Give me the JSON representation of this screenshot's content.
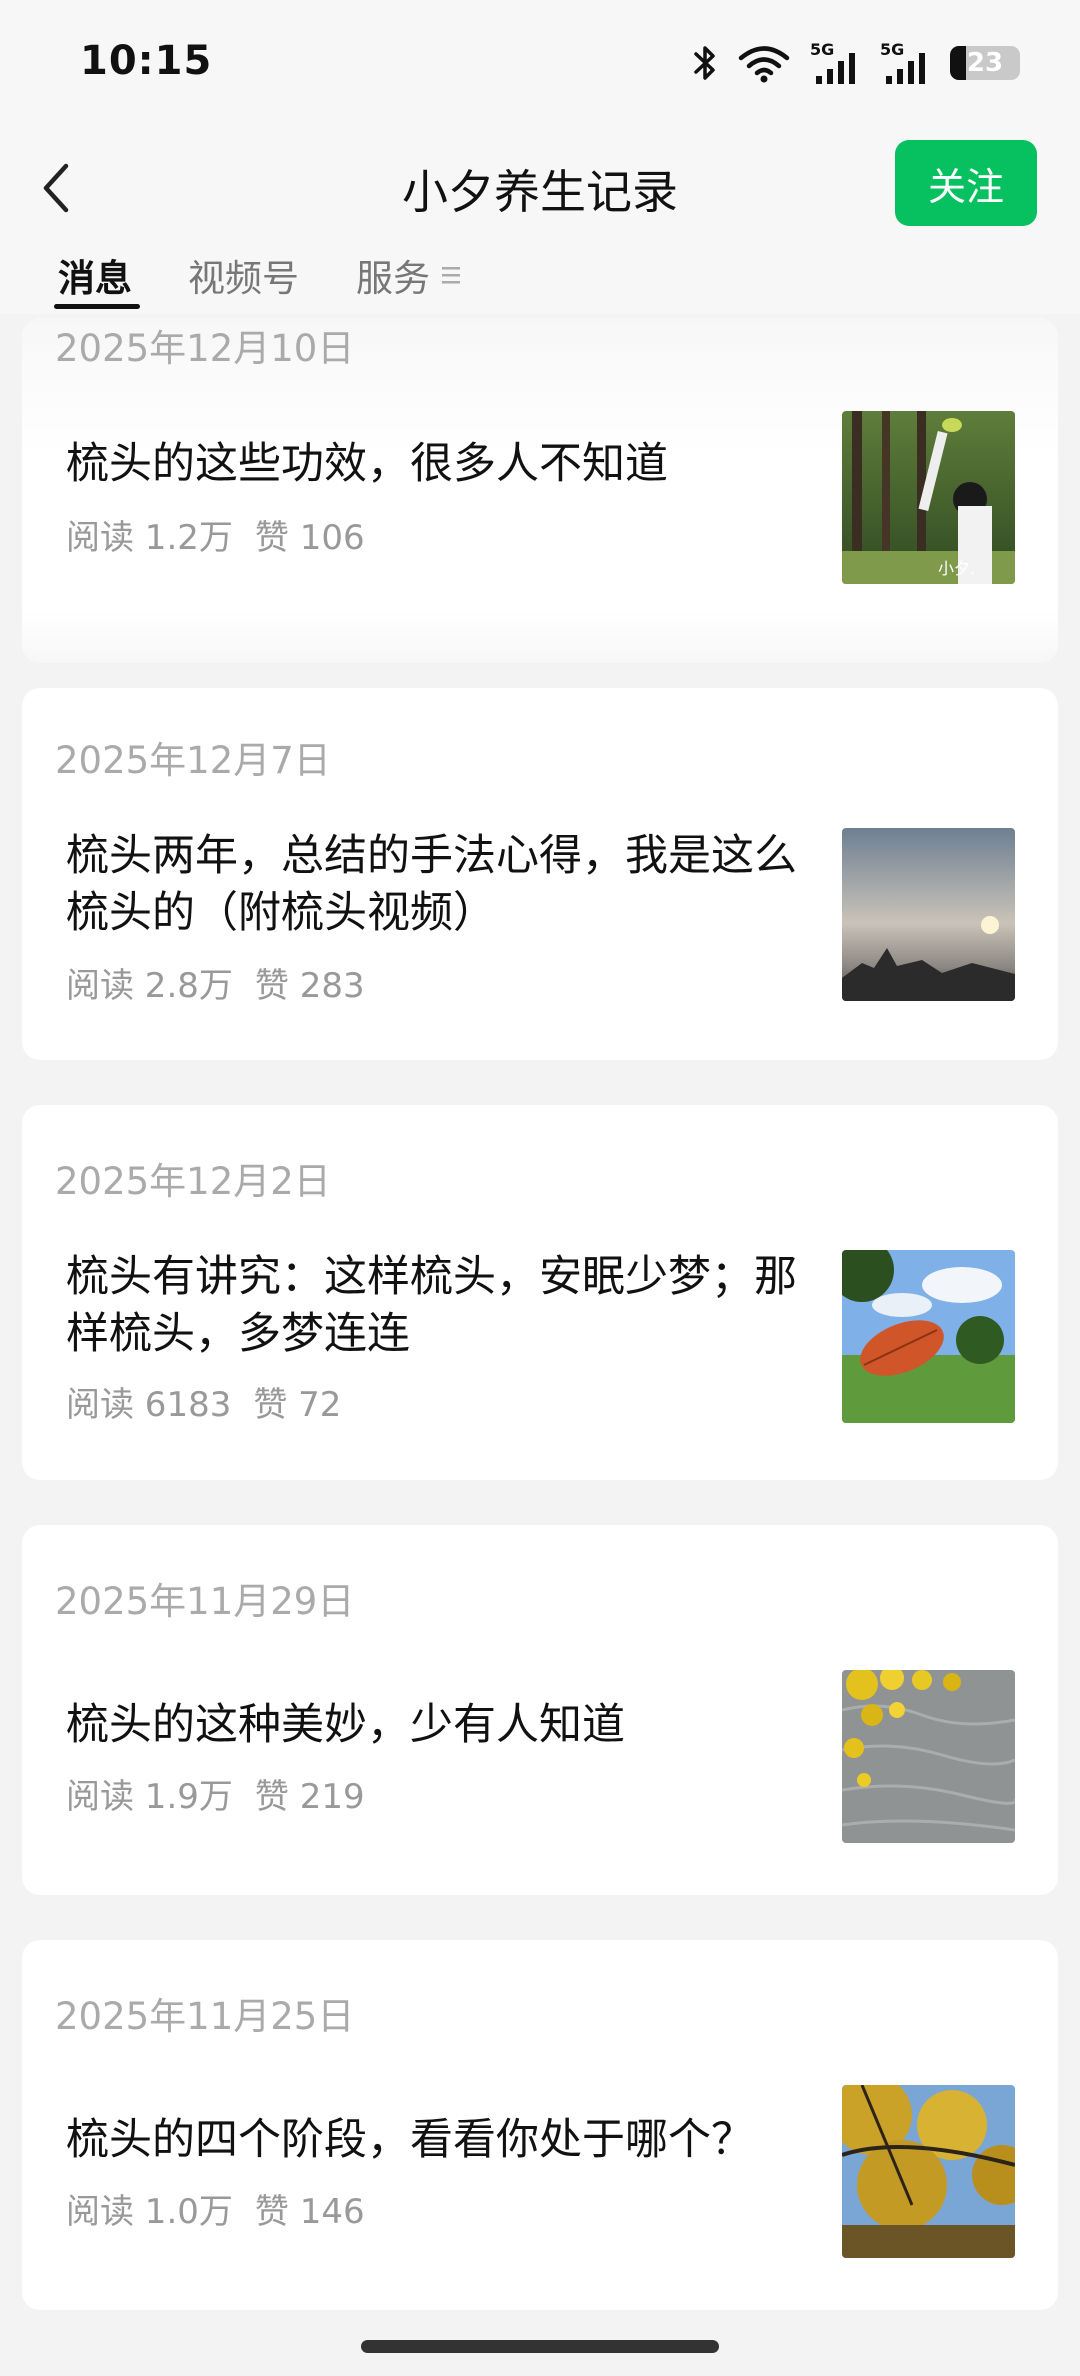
{
  "status_bar": {
    "time": "10:15",
    "signal1": "5G",
    "signal2": "5G",
    "battery": "23",
    "battery_level": 0.23
  },
  "header": {
    "title": "小夕养生记录",
    "follow_label": "关注"
  },
  "tabs": [
    {
      "label": "消息",
      "active": true
    },
    {
      "label": "视频号",
      "active": false
    },
    {
      "label": "服务",
      "active": false
    }
  ],
  "articles": [
    {
      "date": "2025年12月10日",
      "title": "梳头的这些功效，很多人不知道",
      "reads": "阅读 1.2万",
      "likes": "赞 106",
      "thumb_caption": "小夕."
    },
    {
      "date": "2025年12月7日",
      "title": "梳头两年，总结的手法心得，我是这么梳头的（附梳头视频）",
      "reads": "阅读 2.8万",
      "likes": "赞 283"
    },
    {
      "date": "2025年12月2日",
      "title": "梳头有讲究：这样梳头，安眠少梦；那样梳头，多梦连连",
      "reads": "阅读 6183",
      "likes": "赞 72"
    },
    {
      "date": "2025年11月29日",
      "title": "梳头的这种美妙，少有人知道",
      "reads": "阅读 1.9万",
      "likes": "赞 219"
    },
    {
      "date": "2025年11月25日",
      "title": "梳头的四个阶段，看看你处于哪个？",
      "reads": "阅读 1.0万",
      "likes": "赞 146"
    }
  ],
  "colors": {
    "accent": "#07c160",
    "background": "#f3f3f3"
  }
}
